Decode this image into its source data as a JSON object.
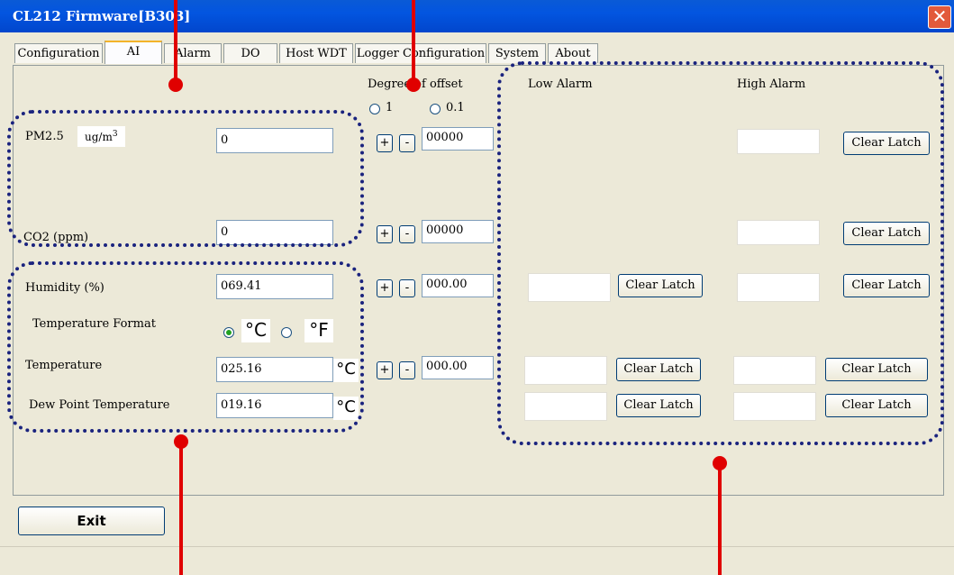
{
  "window": {
    "title": "CL212 Firmware[B303]",
    "close_glyph": "✕"
  },
  "tabs": [
    {
      "label": "Configuration"
    },
    {
      "label": "AI"
    },
    {
      "label": "Alarm"
    },
    {
      "label": "DO"
    },
    {
      "label": "Host WDT"
    },
    {
      "label": "Logger Configuration"
    },
    {
      "label": "System"
    },
    {
      "label": "About"
    }
  ],
  "offset": {
    "title": "Degree of offset",
    "opt1": "1",
    "opt2": "0.1",
    "selected": "none"
  },
  "alarm_headers": {
    "low": "Low Alarm",
    "high": "High Alarm"
  },
  "pm25": {
    "label": "PM2.5",
    "unit_base": "ug/m",
    "unit_exp": "3",
    "value": "0",
    "offset": "00000"
  },
  "co2": {
    "label": "CO2 (ppm)",
    "value": "0",
    "offset": "00000"
  },
  "humidity": {
    "label": "Humidity (%)",
    "value": "069.41",
    "offset": "000.00"
  },
  "temp_format": {
    "label": "Temperature Format",
    "c": "°C",
    "f": "°F",
    "selected": "C"
  },
  "temperature": {
    "label": "Temperature",
    "value": "025.16",
    "unit": "°C",
    "offset": "000.00"
  },
  "dew_point": {
    "label": "Dew Point Temperature",
    "value": "019.16",
    "unit": "°C"
  },
  "buttons": {
    "plus": "+",
    "minus": "-",
    "clear_latch": "Clear Latch",
    "exit": "Exit"
  },
  "colors": {
    "annotation_red": "#e00000",
    "annotation_blue": "#1a237e",
    "titlebar": "#0355e0"
  }
}
